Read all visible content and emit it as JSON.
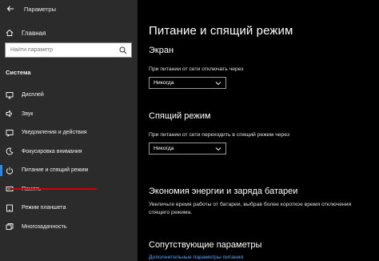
{
  "window": {
    "title": "Параметры"
  },
  "sidebar": {
    "home_label": "Главная",
    "search_placeholder": "Найти параметр",
    "section": "Система",
    "items": [
      {
        "label": "Дисплей",
        "icon": "display-icon"
      },
      {
        "label": "Звук",
        "icon": "speaker-icon"
      },
      {
        "label": "Уведомления и действия",
        "icon": "notifications-icon"
      },
      {
        "label": "Фокусировка внимания",
        "icon": "moon-icon"
      },
      {
        "label": "Питание и спящий режим",
        "icon": "power-icon",
        "active": true
      },
      {
        "label": "Память",
        "icon": "storage-icon"
      },
      {
        "label": "Режим планшета",
        "icon": "tablet-icon"
      },
      {
        "label": "Многозадачность",
        "icon": "multitasking-icon"
      }
    ]
  },
  "main": {
    "title": "Питание и спящий режим",
    "screen": {
      "heading": "Экран",
      "description": "При питании от сети отключать через",
      "value": "Никогда"
    },
    "sleep": {
      "heading": "Спящий режим",
      "description": "При питании от сети переходить в спящий режим через",
      "value": "Никогда"
    },
    "battery": {
      "heading": "Экономия энергии и заряда батареи",
      "description_line1": "Увеличьте время работы от батареи, выбрав более короткое время отключения",
      "description_line2": "спящего режима."
    },
    "related": {
      "heading": "Сопутствующие параметры",
      "link": "Дополнительные параметры питания"
    }
  },
  "colors": {
    "accent": "#1a8cff",
    "underline": "#d40000",
    "link": "#4ea6ff"
  }
}
